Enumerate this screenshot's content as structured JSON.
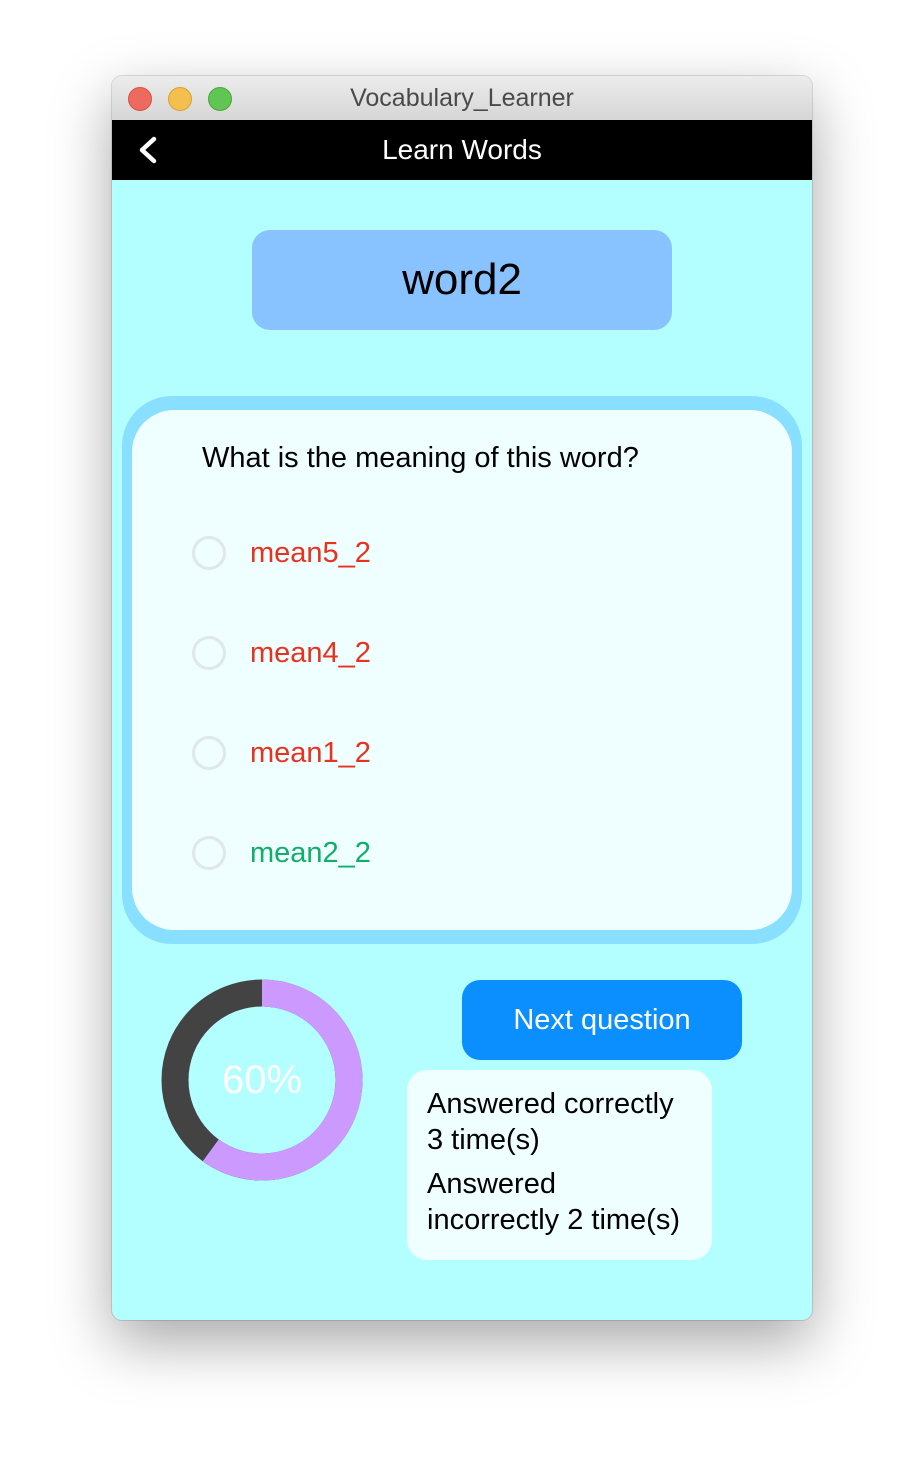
{
  "window": {
    "title": "Vocabulary_Learner"
  },
  "appbar": {
    "title": "Learn Words",
    "back_icon": "chevron-left-icon"
  },
  "word": "word2",
  "question": {
    "text": "What is the meaning of this word?",
    "options": [
      {
        "label": "mean5_2",
        "color": "#e8321e",
        "selected": false
      },
      {
        "label": "mean4_2",
        "color": "#e8321e",
        "selected": false
      },
      {
        "label": "mean1_2",
        "color": "#e8321e",
        "selected": false
      },
      {
        "label": "mean2_2",
        "color": "#10ad6b",
        "selected": false
      }
    ]
  },
  "progress": {
    "label": "60%",
    "percent": 60,
    "fill_color": "#cc99ff",
    "track_color": "#434343"
  },
  "next_button": {
    "label": "Next question"
  },
  "stats": {
    "correct": "Answered correctly 3 time(s)",
    "incorrect": "Answered incorrectly 2 time(s)"
  },
  "colors": {
    "background": "#b3fefe",
    "word_card": "#89c3ff",
    "question_border": "#88dfff",
    "button": "#0b8ffe"
  }
}
